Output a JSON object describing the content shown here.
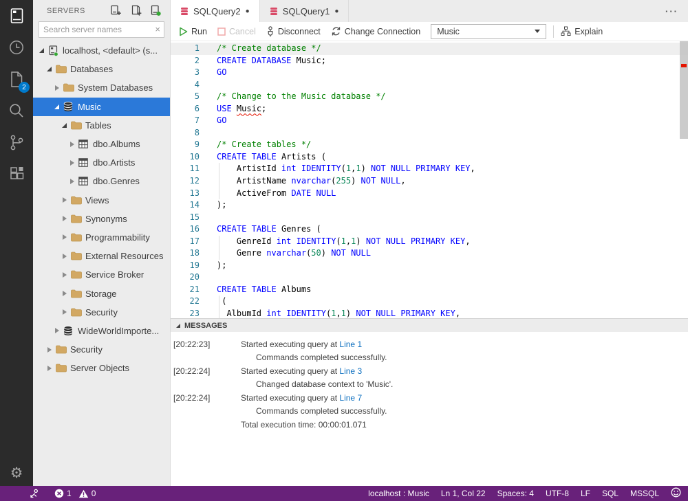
{
  "activity_bar": {
    "icons": [
      {
        "name": "connections",
        "active": true
      },
      {
        "name": "task-history",
        "active": false
      },
      {
        "name": "open-editors",
        "active": false,
        "badge": "2"
      },
      {
        "name": "search",
        "active": false
      },
      {
        "name": "source-control",
        "active": false
      },
      {
        "name": "extensions",
        "active": false
      }
    ],
    "settings_icon": "settings-gear"
  },
  "sidebar": {
    "title": "SERVERS",
    "search_placeholder": "Search server names",
    "header_icons": [
      "new-connection",
      "new-server-group",
      "active-connections"
    ],
    "tree": [
      {
        "label": "localhost, <default> (s...",
        "level": 0,
        "state": "expanded",
        "icon": "server",
        "selected": false
      },
      {
        "label": "Databases",
        "level": 1,
        "state": "expanded",
        "icon": "folder",
        "selected": false
      },
      {
        "label": "System Databases",
        "level": 2,
        "state": "collapsed",
        "icon": "folder",
        "selected": false
      },
      {
        "label": "Music",
        "level": 2,
        "state": "expanded",
        "icon": "database",
        "selected": true
      },
      {
        "label": "Tables",
        "level": 3,
        "state": "expanded",
        "icon": "folder",
        "selected": false
      },
      {
        "label": "dbo.Albums",
        "level": 4,
        "state": "collapsed",
        "icon": "table",
        "selected": false
      },
      {
        "label": "dbo.Artists",
        "level": 4,
        "state": "collapsed",
        "icon": "table",
        "selected": false
      },
      {
        "label": "dbo.Genres",
        "level": 4,
        "state": "collapsed",
        "icon": "table",
        "selected": false
      },
      {
        "label": "Views",
        "level": 3,
        "state": "collapsed",
        "icon": "folder",
        "selected": false
      },
      {
        "label": "Synonyms",
        "level": 3,
        "state": "collapsed",
        "icon": "folder",
        "selected": false
      },
      {
        "label": "Programmability",
        "level": 3,
        "state": "collapsed",
        "icon": "folder",
        "selected": false
      },
      {
        "label": "External Resources",
        "level": 3,
        "state": "collapsed",
        "icon": "folder",
        "selected": false
      },
      {
        "label": "Service Broker",
        "level": 3,
        "state": "collapsed",
        "icon": "folder",
        "selected": false
      },
      {
        "label": "Storage",
        "level": 3,
        "state": "collapsed",
        "icon": "folder",
        "selected": false
      },
      {
        "label": "Security",
        "level": 3,
        "state": "collapsed",
        "icon": "folder",
        "selected": false
      },
      {
        "label": "WideWorldImporte...",
        "level": 2,
        "state": "collapsed",
        "icon": "database",
        "selected": false
      },
      {
        "label": "Security",
        "level": 1,
        "state": "collapsed",
        "icon": "folder",
        "selected": false
      },
      {
        "label": "Server Objects",
        "level": 1,
        "state": "collapsed",
        "icon": "folder",
        "selected": false
      }
    ]
  },
  "tabs": [
    {
      "label": "SQLQuery2",
      "dirty": true,
      "active": true
    },
    {
      "label": "SQLQuery1",
      "dirty": true,
      "active": false
    }
  ],
  "toolbar": {
    "run": "Run",
    "cancel": "Cancel",
    "disconnect": "Disconnect",
    "change_connection": "Change Connection",
    "database_dropdown": "Music",
    "explain": "Explain"
  },
  "editor": {
    "cursor_line": 1,
    "lines": [
      {
        "n": 1,
        "tokens": [
          [
            "c",
            "/* Create database */"
          ]
        ]
      },
      {
        "n": 2,
        "tokens": [
          [
            "k",
            "CREATE"
          ],
          [
            "p",
            " "
          ],
          [
            "k",
            "DATABASE"
          ],
          [
            "p",
            " Music;"
          ]
        ]
      },
      {
        "n": 3,
        "tokens": [
          [
            "k",
            "GO"
          ]
        ]
      },
      {
        "n": 4,
        "tokens": []
      },
      {
        "n": 5,
        "tokens": [
          [
            "c",
            "/* Change to the Music database */"
          ]
        ]
      },
      {
        "n": 6,
        "tokens": [
          [
            "k",
            "USE"
          ],
          [
            "p",
            " "
          ],
          [
            "e",
            "Music"
          ],
          [
            "p",
            ";"
          ]
        ]
      },
      {
        "n": 7,
        "tokens": [
          [
            "k",
            "GO"
          ]
        ]
      },
      {
        "n": 8,
        "tokens": []
      },
      {
        "n": 9,
        "tokens": [
          [
            "c",
            "/* Create tables */"
          ]
        ]
      },
      {
        "n": 10,
        "tokens": [
          [
            "k",
            "CREATE"
          ],
          [
            "p",
            " "
          ],
          [
            "k",
            "TABLE"
          ],
          [
            "p",
            " Artists ("
          ]
        ]
      },
      {
        "n": 11,
        "tokens": [
          [
            "p",
            "    ArtistId "
          ],
          [
            "k",
            "int"
          ],
          [
            "p",
            " "
          ],
          [
            "k",
            "IDENTITY"
          ],
          [
            "p",
            "("
          ],
          [
            "n",
            "1"
          ],
          [
            "p",
            ","
          ],
          [
            "n",
            "1"
          ],
          [
            "p",
            ") "
          ],
          [
            "k",
            "NOT NULL PRIMARY KEY"
          ],
          [
            "p",
            ","
          ]
        ]
      },
      {
        "n": 12,
        "tokens": [
          [
            "p",
            "    ArtistName "
          ],
          [
            "k",
            "nvarchar"
          ],
          [
            "p",
            "("
          ],
          [
            "n",
            "255"
          ],
          [
            "p",
            ") "
          ],
          [
            "k",
            "NOT NULL"
          ],
          [
            "p",
            ","
          ]
        ]
      },
      {
        "n": 13,
        "tokens": [
          [
            "p",
            "    ActiveFrom "
          ],
          [
            "k",
            "DATE NULL"
          ]
        ]
      },
      {
        "n": 14,
        "tokens": [
          [
            "p",
            ");"
          ]
        ]
      },
      {
        "n": 15,
        "tokens": []
      },
      {
        "n": 16,
        "tokens": [
          [
            "k",
            "CREATE"
          ],
          [
            "p",
            " "
          ],
          [
            "k",
            "TABLE"
          ],
          [
            "p",
            " Genres ("
          ]
        ]
      },
      {
        "n": 17,
        "tokens": [
          [
            "p",
            "    GenreId "
          ],
          [
            "k",
            "int"
          ],
          [
            "p",
            " "
          ],
          [
            "k",
            "IDENTITY"
          ],
          [
            "p",
            "("
          ],
          [
            "n",
            "1"
          ],
          [
            "p",
            ","
          ],
          [
            "n",
            "1"
          ],
          [
            "p",
            ") "
          ],
          [
            "k",
            "NOT NULL PRIMARY KEY"
          ],
          [
            "p",
            ","
          ]
        ]
      },
      {
        "n": 18,
        "tokens": [
          [
            "p",
            "    Genre "
          ],
          [
            "k",
            "nvarchar"
          ],
          [
            "p",
            "("
          ],
          [
            "n",
            "50"
          ],
          [
            "p",
            ") "
          ],
          [
            "k",
            "NOT NULL"
          ]
        ]
      },
      {
        "n": 19,
        "tokens": [
          [
            "p",
            ");"
          ]
        ]
      },
      {
        "n": 20,
        "tokens": []
      },
      {
        "n": 21,
        "tokens": [
          [
            "k",
            "CREATE"
          ],
          [
            "p",
            " "
          ],
          [
            "k",
            "TABLE"
          ],
          [
            "p",
            " Albums"
          ]
        ]
      },
      {
        "n": 22,
        "tokens": [
          [
            "p",
            " ("
          ]
        ]
      },
      {
        "n": 23,
        "tokens": [
          [
            "p",
            "  AlbumId "
          ],
          [
            "k",
            "int"
          ],
          [
            "p",
            " "
          ],
          [
            "k",
            "IDENTITY"
          ],
          [
            "p",
            "("
          ],
          [
            "n",
            "1"
          ],
          [
            "p",
            ","
          ],
          [
            "n",
            "1"
          ],
          [
            "p",
            ") "
          ],
          [
            "k",
            "NOT NULL PRIMARY KEY"
          ],
          [
            "p",
            ","
          ]
        ]
      }
    ]
  },
  "messages": {
    "header": "MESSAGES",
    "rows": [
      {
        "ts": "[20:22:23]",
        "text": "Started executing query at ",
        "link": "Line 1",
        "indent": false
      },
      {
        "ts": "",
        "text": "Commands completed successfully.",
        "link": "",
        "indent": true
      },
      {
        "ts": "[20:22:24]",
        "text": "Started executing query at ",
        "link": "Line 3",
        "indent": false
      },
      {
        "ts": "",
        "text": "Changed database context to 'Music'.",
        "link": "",
        "indent": true
      },
      {
        "ts": "[20:22:24]",
        "text": "Started executing query at ",
        "link": "Line 7",
        "indent": false
      },
      {
        "ts": "",
        "text": "Commands completed successfully.",
        "link": "",
        "indent": true
      },
      {
        "ts": "",
        "text": "Total execution time: 00:00:01.071",
        "link": "",
        "indent": false
      }
    ]
  },
  "status_bar": {
    "error_count": "1",
    "warning_count": "0",
    "items_right": [
      "localhost : Music",
      "Ln 1, Col 22",
      "Spaces: 4",
      "UTF-8",
      "LF",
      "SQL",
      "MSSQL"
    ]
  },
  "colors": {
    "status_bar": "#68217A",
    "selection": "#2B79D9",
    "badge": "#007ACC",
    "keyword": "#0000FF",
    "comment": "#008000",
    "number": "#098658",
    "error_marker": "#E51400",
    "link": "#0E70C0",
    "tab_icon": "#D94A67"
  }
}
